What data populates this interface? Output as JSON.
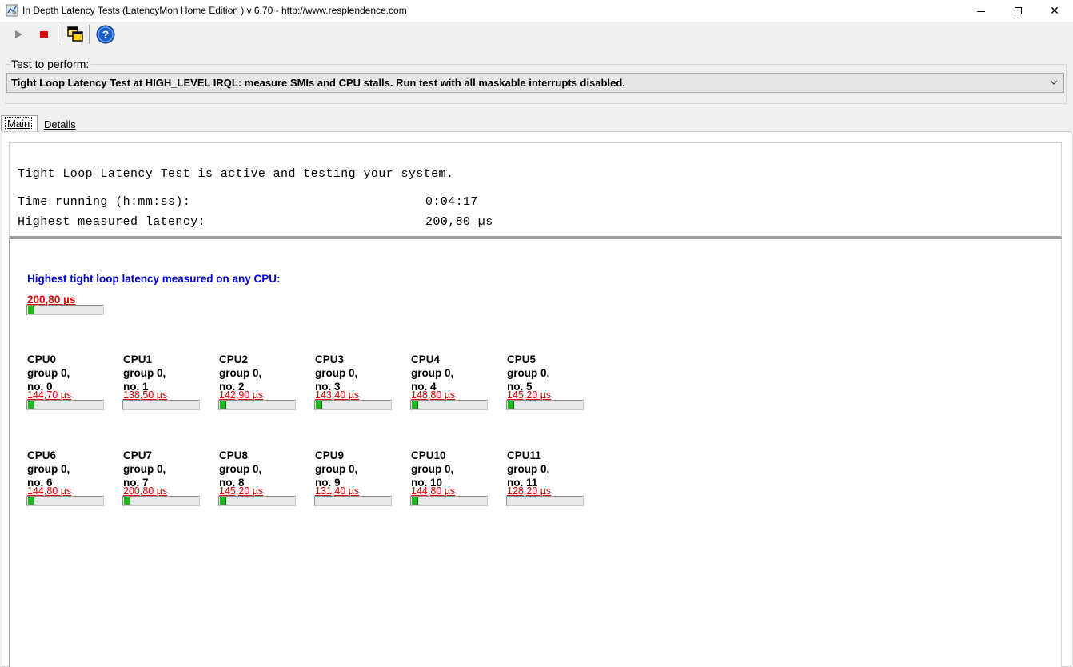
{
  "window": {
    "title": "In Depth Latency Tests  (LatencyMon Home Edition )  v 6.70 - http://www.resplendence.com",
    "minimize": "—",
    "close": "✕"
  },
  "toolbar": {
    "play": "play-icon",
    "stop": "stop-icon",
    "windows": "windows-icon",
    "help": "help-icon"
  },
  "test": {
    "label": "Test to perform:",
    "selected": "Tight Loop Latency Test at HIGH_LEVEL IRQL:  measure SMIs and CPU stalls. Run test with all maskable interrupts disabled."
  },
  "tabs": {
    "main": "Main",
    "details": "Details"
  },
  "status": {
    "active": "Tight Loop Latency Test is active and testing your system.",
    "time_label": "Time running (h:mm:ss):",
    "time_value": "0:04:17",
    "highest_label": "Highest measured latency:",
    "highest_value": "200,80 µs"
  },
  "overall": {
    "title": "Highest tight loop latency measured on any CPU:",
    "value": "200,80 µs",
    "level": 0.08
  },
  "cpus": [
    {
      "name": "CPU0",
      "group": "group 0,",
      "no": "no. 0",
      "value": "144,70 µs",
      "level": 0.08
    },
    {
      "name": "CPU1",
      "group": "group 0,",
      "no": "no. 1",
      "value": "138,50 µs",
      "level": 0.0
    },
    {
      "name": "CPU2",
      "group": "group 0,",
      "no": "no. 2",
      "value": "142,90 µs",
      "level": 0.08
    },
    {
      "name": "CPU3",
      "group": "group 0,",
      "no": "no. 3",
      "value": "143,40 µs",
      "level": 0.08
    },
    {
      "name": "CPU4",
      "group": "group 0,",
      "no": "no. 4",
      "value": "148,80 µs",
      "level": 0.08
    },
    {
      "name": "CPU5",
      "group": "group 0,",
      "no": "no. 5",
      "value": "145,20 µs",
      "level": 0.08
    },
    {
      "name": "CPU6",
      "group": "group 0,",
      "no": "no. 6",
      "value": "144,80 µs",
      "level": 0.08
    },
    {
      "name": "CPU7",
      "group": "group 0,",
      "no": "no. 7",
      "value": "200,80 µs",
      "level": 0.08
    },
    {
      "name": "CPU8",
      "group": "group 0,",
      "no": "no. 8",
      "value": "145,20 µs",
      "level": 0.08
    },
    {
      "name": "CPU9",
      "group": "group 0,",
      "no": "no. 9",
      "value": "131,40 µs",
      "level": 0.0
    },
    {
      "name": "CPU10",
      "group": "group 0,",
      "no": "no. 10",
      "value": "144,80 µs",
      "level": 0.08
    },
    {
      "name": "CPU11",
      "group": "group 0,",
      "no": "no. 11",
      "value": "128,20 µs",
      "level": 0.0
    }
  ],
  "colors": {
    "bar_fill": "#1fb51f",
    "value_red": "#e00000",
    "title_blue": "#0000e0"
  }
}
